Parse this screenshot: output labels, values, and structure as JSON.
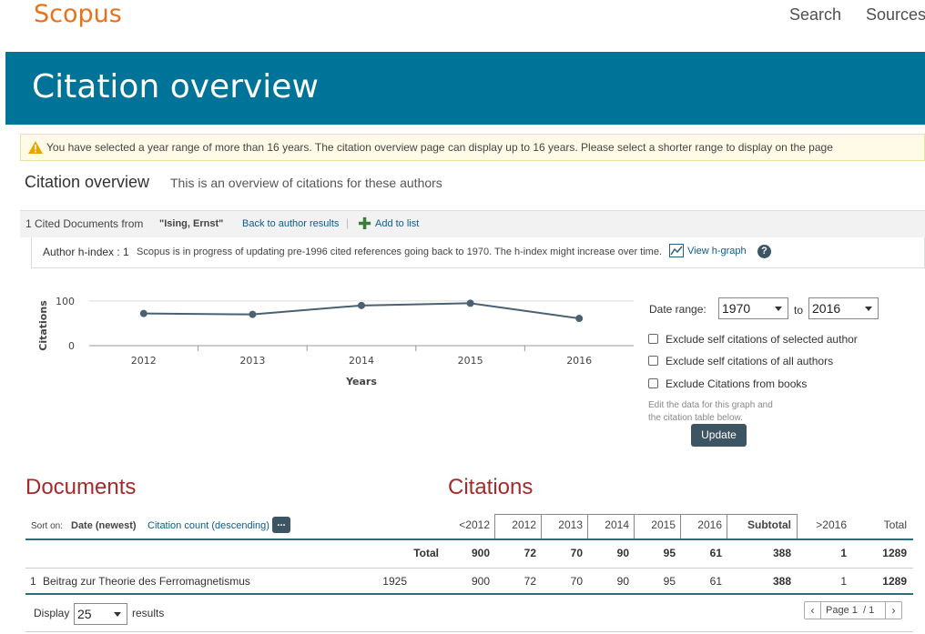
{
  "header": {
    "logo": "Scopus",
    "nav": [
      "Search",
      "Sources"
    ]
  },
  "banner": {
    "title": "Citation overview"
  },
  "warning": {
    "text": "You have selected a year range of more than 16 years. The citation overview page can display up to 16 years. Please select a shorter range to display on the page"
  },
  "overview": {
    "title": "Citation overview",
    "subtitle": "This is an overview of citations for these authors"
  },
  "docs_bar": {
    "cited": "1 Cited Documents from",
    "author": "\"Ising, Ernst\"",
    "back": "Back to author results",
    "separator": "|",
    "add": "Add to list"
  },
  "hindex": {
    "label": "Author h-index : 1",
    "note": "Scopus is in progress of updating pre-1996 cited references going back to 1970. The h-index might increase over time.",
    "view": "View h-graph",
    "help": "?"
  },
  "chart_data": {
    "type": "line",
    "x": [
      "2012",
      "2013",
      "2014",
      "2015",
      "2016"
    ],
    "series": [
      {
        "values": [
          72,
          70,
          90,
          95,
          61
        ]
      }
    ],
    "xlabel": "Years",
    "ylabel": "Citations",
    "yticks": [
      0,
      100
    ],
    "ylim": [
      0,
      110
    ],
    "color": "#4a6073"
  },
  "controls": {
    "date_range_label": "Date range:",
    "from": "1970",
    "to_label": "to",
    "to": "2016",
    "options": [
      "Exclude self citations of selected author",
      "Exclude self citations of all authors",
      "Exclude Citations from books"
    ],
    "edit_note_1": "Edit the data for this graph and",
    "edit_note_2": "the citation table below.",
    "update": "Update"
  },
  "table": {
    "docs_heading": "Documents",
    "cits_heading": "Citations",
    "sort_on": "Sort on:",
    "sort_date": "Date (newest)",
    "sort_cit": "Citation count (descending)",
    "more": "...",
    "columns": [
      "<2012",
      "2012",
      "2013",
      "2014",
      "2015",
      "2016",
      "Subtotal",
      ">2016",
      "Total"
    ],
    "total_label": "Total",
    "totals": [
      "900",
      "72",
      "70",
      "90",
      "95",
      "61",
      "388",
      "1",
      "1289"
    ],
    "rows": [
      {
        "num": "1",
        "title": "Beitrag zur Theorie des Ferromagnetismus",
        "year": "1925",
        "values": [
          "900",
          "72",
          "70",
          "90",
          "95",
          "61",
          "388",
          "1",
          "1289"
        ]
      }
    ]
  },
  "footer": {
    "display": "Display",
    "per_page": "25",
    "results": "results",
    "page": "Page 1",
    "of": "/ 1"
  }
}
